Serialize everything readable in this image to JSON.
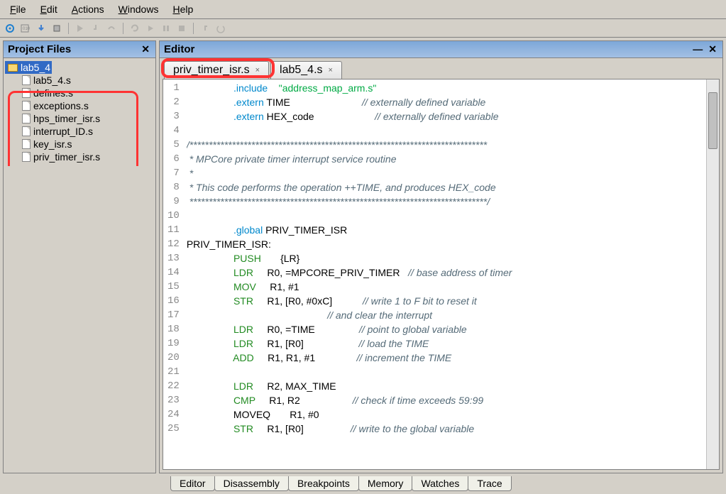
{
  "menu": {
    "file": "File",
    "edit": "Edit",
    "actions": "Actions",
    "windows": "Windows",
    "help": "Help"
  },
  "panels": {
    "project_title": "Project Files",
    "editor_title": "Editor"
  },
  "tree": {
    "root": "lab5_4",
    "files": [
      "lab5_4.s",
      "defines.s",
      "exceptions.s",
      "hps_timer_isr.s",
      "interrupt_ID.s",
      "key_isr.s",
      "priv_timer_isr.s"
    ]
  },
  "tabs": [
    {
      "label": "priv_timer_isr.s"
    },
    {
      "label": "lab5_4.s"
    }
  ],
  "bottom_tabs": [
    "Editor",
    "Disassembly",
    "Breakpoints",
    "Memory",
    "Watches",
    "Trace"
  ],
  "code": {
    "lines": [
      {
        "n": 1,
        "seg": [
          [
            "plain",
            "                 "
          ],
          [
            "dir",
            ".include"
          ],
          [
            "plain",
            "    "
          ],
          [
            "str",
            "\"address_map_arm.s\""
          ]
        ]
      },
      {
        "n": 2,
        "seg": [
          [
            "plain",
            "                 "
          ],
          [
            "dir",
            ".extern"
          ],
          [
            "plain",
            " TIME                          "
          ],
          [
            "cmt",
            "// externally defined variable"
          ]
        ]
      },
      {
        "n": 3,
        "seg": [
          [
            "plain",
            "                 "
          ],
          [
            "dir",
            ".extern"
          ],
          [
            "plain",
            " HEX_code                      "
          ],
          [
            "cmt",
            "// externally defined variable"
          ]
        ]
      },
      {
        "n": 4,
        "seg": []
      },
      {
        "n": 5,
        "seg": [
          [
            "cmt",
            "/*****************************************************************************"
          ]
        ]
      },
      {
        "n": 6,
        "seg": [
          [
            "cmt",
            " * MPCore private timer interrupt service routine                                "
          ]
        ]
      },
      {
        "n": 7,
        "seg": [
          [
            "cmt",
            " *                                                                          "
          ]
        ]
      },
      {
        "n": 8,
        "seg": [
          [
            "cmt",
            " * This code performs the operation ++TIME, and produces HEX_code           "
          ]
        ]
      },
      {
        "n": 9,
        "seg": [
          [
            "cmt",
            " *****************************************************************************/"
          ]
        ]
      },
      {
        "n": 10,
        "seg": []
      },
      {
        "n": 11,
        "seg": [
          [
            "plain",
            "                 "
          ],
          [
            "dir",
            ".global"
          ],
          [
            "plain",
            " PRIV_TIMER_ISR"
          ]
        ]
      },
      {
        "n": 12,
        "seg": [
          [
            "plain",
            "PRIV_TIMER_ISR:"
          ]
        ]
      },
      {
        "n": 13,
        "seg": [
          [
            "plain",
            "                 "
          ],
          [
            "ins",
            "PUSH"
          ],
          [
            "plain",
            "       {LR}"
          ]
        ]
      },
      {
        "n": 14,
        "seg": [
          [
            "plain",
            "                 "
          ],
          [
            "ins",
            "LDR"
          ],
          [
            "plain",
            "     R0, =MPCORE_PRIV_TIMER   "
          ],
          [
            "cmt",
            "// base address of timer"
          ]
        ]
      },
      {
        "n": 15,
        "seg": [
          [
            "plain",
            "                 "
          ],
          [
            "ins",
            "MOV"
          ],
          [
            "plain",
            "     R1, #1"
          ]
        ]
      },
      {
        "n": 16,
        "seg": [
          [
            "plain",
            "                 "
          ],
          [
            "ins",
            "STR"
          ],
          [
            "plain",
            "     R1, [R0, #0xC]           "
          ],
          [
            "cmt",
            "// write 1 to F bit to reset it"
          ]
        ]
      },
      {
        "n": 17,
        "seg": [
          [
            "plain",
            "                                                   "
          ],
          [
            "cmt",
            "// and clear the interrupt"
          ]
        ]
      },
      {
        "n": 18,
        "seg": [
          [
            "plain",
            "                 "
          ],
          [
            "ins",
            "LDR"
          ],
          [
            "plain",
            "     R0, =TIME                "
          ],
          [
            "cmt",
            "// point to global variable"
          ]
        ]
      },
      {
        "n": 19,
        "seg": [
          [
            "plain",
            "                 "
          ],
          [
            "ins",
            "LDR"
          ],
          [
            "plain",
            "     R1, [R0]                    "
          ],
          [
            "cmt",
            "// load the TIME"
          ]
        ]
      },
      {
        "n": 20,
        "seg": [
          [
            "plain",
            "                 "
          ],
          [
            "ins",
            "ADD"
          ],
          [
            "plain",
            "     R1, R1, #1               "
          ],
          [
            "cmt",
            "// increment the TIME"
          ]
        ]
      },
      {
        "n": 21,
        "seg": []
      },
      {
        "n": 22,
        "seg": [
          [
            "plain",
            "                 "
          ],
          [
            "ins",
            "LDR"
          ],
          [
            "plain",
            "     R2, MAX_TIME"
          ]
        ]
      },
      {
        "n": 23,
        "seg": [
          [
            "plain",
            "                 "
          ],
          [
            "ins",
            "CMP"
          ],
          [
            "plain",
            "     R1, R2                   "
          ],
          [
            "cmt",
            "// check if time exceeds 59:99"
          ]
        ]
      },
      {
        "n": 24,
        "seg": [
          [
            "plain",
            "                 MOVEQ       R1, #0"
          ]
        ]
      },
      {
        "n": 25,
        "seg": [
          [
            "plain",
            "                 "
          ],
          [
            "ins",
            "STR"
          ],
          [
            "plain",
            "     R1, [R0]                 "
          ],
          [
            "cmt",
            "// write to the global variable"
          ]
        ]
      }
    ]
  }
}
